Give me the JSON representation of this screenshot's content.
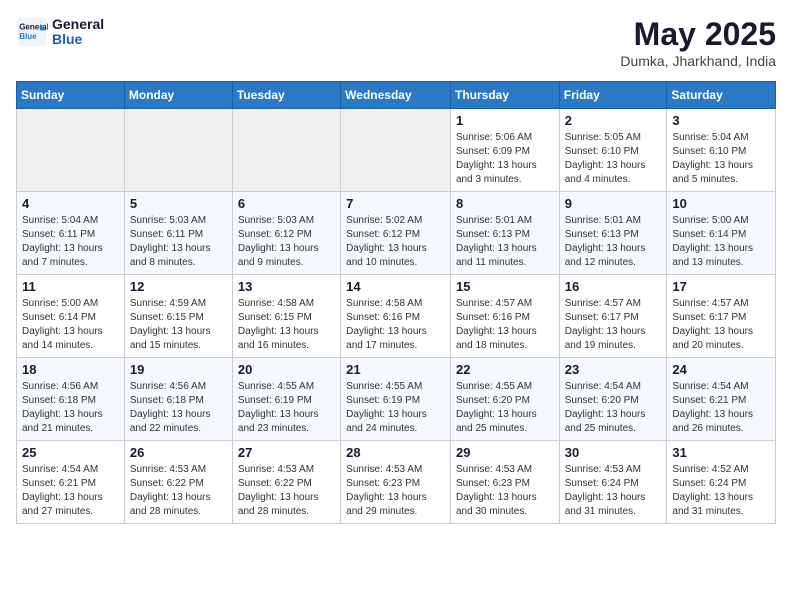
{
  "header": {
    "logo_line1": "General",
    "logo_line2": "Blue",
    "month": "May 2025",
    "location": "Dumka, Jharkhand, India"
  },
  "weekdays": [
    "Sunday",
    "Monday",
    "Tuesday",
    "Wednesday",
    "Thursday",
    "Friday",
    "Saturday"
  ],
  "weeks": [
    [
      {
        "day": "",
        "info": ""
      },
      {
        "day": "",
        "info": ""
      },
      {
        "day": "",
        "info": ""
      },
      {
        "day": "",
        "info": ""
      },
      {
        "day": "1",
        "info": "Sunrise: 5:06 AM\nSunset: 6:09 PM\nDaylight: 13 hours and 3 minutes."
      },
      {
        "day": "2",
        "info": "Sunrise: 5:05 AM\nSunset: 6:10 PM\nDaylight: 13 hours and 4 minutes."
      },
      {
        "day": "3",
        "info": "Sunrise: 5:04 AM\nSunset: 6:10 PM\nDaylight: 13 hours and 5 minutes."
      }
    ],
    [
      {
        "day": "4",
        "info": "Sunrise: 5:04 AM\nSunset: 6:11 PM\nDaylight: 13 hours and 7 minutes."
      },
      {
        "day": "5",
        "info": "Sunrise: 5:03 AM\nSunset: 6:11 PM\nDaylight: 13 hours and 8 minutes."
      },
      {
        "day": "6",
        "info": "Sunrise: 5:03 AM\nSunset: 6:12 PM\nDaylight: 13 hours and 9 minutes."
      },
      {
        "day": "7",
        "info": "Sunrise: 5:02 AM\nSunset: 6:12 PM\nDaylight: 13 hours and 10 minutes."
      },
      {
        "day": "8",
        "info": "Sunrise: 5:01 AM\nSunset: 6:13 PM\nDaylight: 13 hours and 11 minutes."
      },
      {
        "day": "9",
        "info": "Sunrise: 5:01 AM\nSunset: 6:13 PM\nDaylight: 13 hours and 12 minutes."
      },
      {
        "day": "10",
        "info": "Sunrise: 5:00 AM\nSunset: 6:14 PM\nDaylight: 13 hours and 13 minutes."
      }
    ],
    [
      {
        "day": "11",
        "info": "Sunrise: 5:00 AM\nSunset: 6:14 PM\nDaylight: 13 hours and 14 minutes."
      },
      {
        "day": "12",
        "info": "Sunrise: 4:59 AM\nSunset: 6:15 PM\nDaylight: 13 hours and 15 minutes."
      },
      {
        "day": "13",
        "info": "Sunrise: 4:58 AM\nSunset: 6:15 PM\nDaylight: 13 hours and 16 minutes."
      },
      {
        "day": "14",
        "info": "Sunrise: 4:58 AM\nSunset: 6:16 PM\nDaylight: 13 hours and 17 minutes."
      },
      {
        "day": "15",
        "info": "Sunrise: 4:57 AM\nSunset: 6:16 PM\nDaylight: 13 hours and 18 minutes."
      },
      {
        "day": "16",
        "info": "Sunrise: 4:57 AM\nSunset: 6:17 PM\nDaylight: 13 hours and 19 minutes."
      },
      {
        "day": "17",
        "info": "Sunrise: 4:57 AM\nSunset: 6:17 PM\nDaylight: 13 hours and 20 minutes."
      }
    ],
    [
      {
        "day": "18",
        "info": "Sunrise: 4:56 AM\nSunset: 6:18 PM\nDaylight: 13 hours and 21 minutes."
      },
      {
        "day": "19",
        "info": "Sunrise: 4:56 AM\nSunset: 6:18 PM\nDaylight: 13 hours and 22 minutes."
      },
      {
        "day": "20",
        "info": "Sunrise: 4:55 AM\nSunset: 6:19 PM\nDaylight: 13 hours and 23 minutes."
      },
      {
        "day": "21",
        "info": "Sunrise: 4:55 AM\nSunset: 6:19 PM\nDaylight: 13 hours and 24 minutes."
      },
      {
        "day": "22",
        "info": "Sunrise: 4:55 AM\nSunset: 6:20 PM\nDaylight: 13 hours and 25 minutes."
      },
      {
        "day": "23",
        "info": "Sunrise: 4:54 AM\nSunset: 6:20 PM\nDaylight: 13 hours and 25 minutes."
      },
      {
        "day": "24",
        "info": "Sunrise: 4:54 AM\nSunset: 6:21 PM\nDaylight: 13 hours and 26 minutes."
      }
    ],
    [
      {
        "day": "25",
        "info": "Sunrise: 4:54 AM\nSunset: 6:21 PM\nDaylight: 13 hours and 27 minutes."
      },
      {
        "day": "26",
        "info": "Sunrise: 4:53 AM\nSunset: 6:22 PM\nDaylight: 13 hours and 28 minutes."
      },
      {
        "day": "27",
        "info": "Sunrise: 4:53 AM\nSunset: 6:22 PM\nDaylight: 13 hours and 28 minutes."
      },
      {
        "day": "28",
        "info": "Sunrise: 4:53 AM\nSunset: 6:23 PM\nDaylight: 13 hours and 29 minutes."
      },
      {
        "day": "29",
        "info": "Sunrise: 4:53 AM\nSunset: 6:23 PM\nDaylight: 13 hours and 30 minutes."
      },
      {
        "day": "30",
        "info": "Sunrise: 4:53 AM\nSunset: 6:24 PM\nDaylight: 13 hours and 31 minutes."
      },
      {
        "day": "31",
        "info": "Sunrise: 4:52 AM\nSunset: 6:24 PM\nDaylight: 13 hours and 31 minutes."
      }
    ]
  ]
}
